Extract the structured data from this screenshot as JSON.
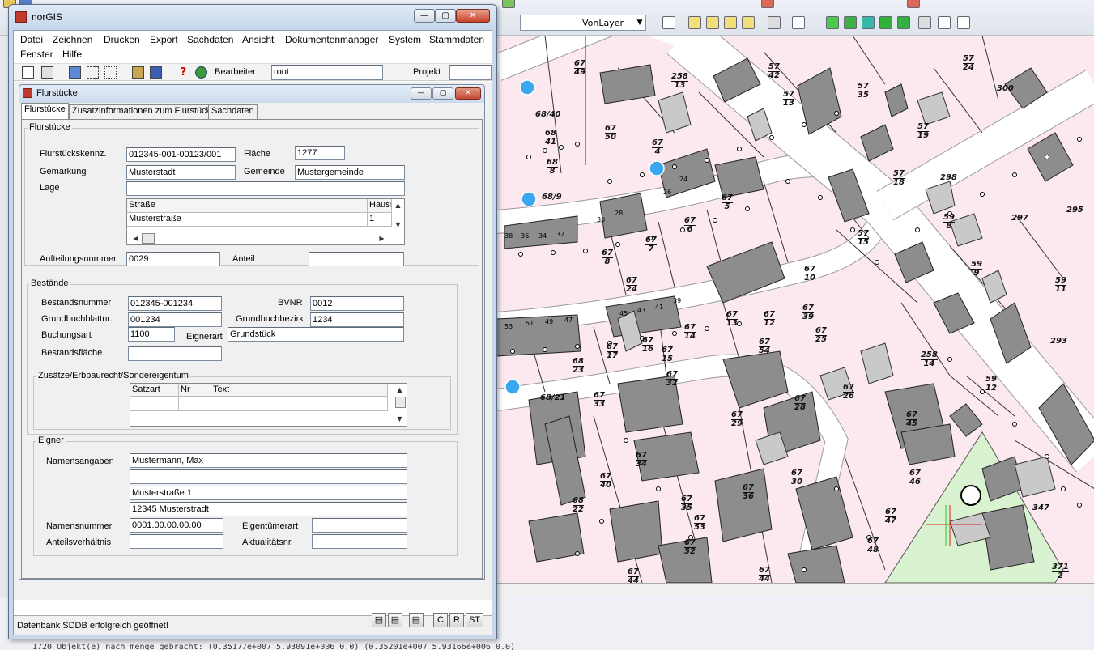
{
  "cad": {
    "layer_select_value": "VonLayer",
    "command_line": "1720 Objekt(e) nach menge gebracht: (0.35177e+007 5.93091e+006 0.0) (0.35201e+007 5.93166e+006 0.0)"
  },
  "window": {
    "title": "norGIS",
    "min": "—",
    "max": "▢",
    "close": "✕"
  },
  "menu": {
    "row1": [
      "Datei",
      "Zeichnen",
      "Drucken",
      "Export",
      "Sachdaten",
      "Ansicht",
      "Dokumentenmanager",
      "System",
      "Stammdaten"
    ],
    "row2": [
      "Fenster",
      "Hilfe"
    ]
  },
  "toolbar": {
    "bearbeiter_label": "Bearbeiter",
    "bearbeiter_value": "root",
    "projekt_label": "Projekt",
    "projekt_value": ""
  },
  "flurstuecke": {
    "title": "Flurstücke",
    "tabs": [
      "Flurstücke",
      "Zusatzinformationen zum Flurstück",
      "Sachdaten"
    ],
    "group_title": "Flurstücke",
    "kennz_label": "Flurstückskennz.",
    "kennz_value": "012345-001-00123/001",
    "flaeche_label": "Fläche",
    "flaeche_value": "1277",
    "gemarkung_label": "Gemarkung",
    "gemarkung_value": "Musterstadt",
    "gemeinde_label": "Gemeinde",
    "gemeinde_value": "Mustergemeinde",
    "lage_label": "Lage",
    "lage_value": "",
    "lage_headers": [
      "Straße",
      "Hausı"
    ],
    "lage_rows": [
      [
        "Musterstraße",
        "1"
      ]
    ],
    "aufteilung_label": "Aufteilungsnummer",
    "aufteilung_value": "0029",
    "anteil_label": "Anteil",
    "anteil_value": ""
  },
  "bestaende": {
    "group_title": "Bestände",
    "bestandsnummer_label": "Bestandsnummer",
    "bestandsnummer_value": "012345-001234",
    "bvnr_label": "BVNR",
    "bvnr_value": "0012",
    "grundbuchblatt_label": "Grundbuchblattnr.",
    "grundbuchblatt_value": "001234",
    "grundbuchbezirk_label": "Grundbuchbezirk",
    "grundbuchbezirk_value": "1234",
    "buchungsart_label": "Buchungsart",
    "buchungsart_value": "1100",
    "eignerart_label": "Eignerart",
    "eignerart_value": "Grundstück",
    "bestandsflaeche_label": "Bestandsfläche",
    "bestandsflaeche_value": "",
    "zusaetze_title": "Zusätze/Erbbaurecht/Sondereigentum",
    "zusaetze_headers": [
      "Satzart",
      "Nr",
      "Text"
    ]
  },
  "eigner": {
    "group_title": "Eigner",
    "namensangaben_label": "Namensangaben",
    "name_lines": [
      "Mustermann, Max",
      "",
      "Musterstraße 1",
      "12345 Musterstradt"
    ],
    "namensnummer_label": "Namensnummer",
    "namensnummer_value": "0001.00.00.00.00",
    "eigentuemerart_label": "Eigentümerart",
    "eigentuemerart_value": "",
    "anteilsverhaeltnis_label": "Anteilsverhältnis",
    "anteilsverhaeltnis_value": "",
    "aktualitaet_label": "Aktualitätsnr.",
    "aktualitaet_value": ""
  },
  "status": {
    "message": "Datenbank SDDB erfolgreich geöffnet!",
    "btn_c": "C",
    "btn_r": "R",
    "btn_st": "ST"
  },
  "map_labels": {
    "parcels": [
      {
        "n": "67",
        "d": "49"
      },
      {
        "n": "258",
        "d": "13"
      },
      {
        "n": "57",
        "d": "42"
      },
      {
        "n": "57",
        "d": "24"
      },
      {
        "n": "67",
        "d": "50"
      },
      {
        "n": "67",
        "d": "4"
      },
      {
        "n": "57",
        "d": "13"
      },
      {
        "n": "57",
        "d": "35"
      },
      {
        "n": "68",
        "d": "41"
      },
      {
        "n": "68",
        "d": "8"
      },
      {
        "n": "57",
        "d": "19"
      },
      {
        "n": "57",
        "d": "18"
      },
      {
        "n": "67",
        "d": "5"
      },
      {
        "n": "67",
        "d": "6"
      },
      {
        "n": "59",
        "d": "8"
      },
      {
        "n": "57",
        "d": "15"
      },
      {
        "n": "67",
        "d": "7"
      },
      {
        "n": "67",
        "d": "8"
      },
      {
        "n": "59",
        "d": "9"
      },
      {
        "n": "59",
        "d": "11"
      },
      {
        "n": "67",
        "d": "10"
      },
      {
        "n": "67",
        "d": "24"
      },
      {
        "n": "67",
        "d": "13"
      },
      {
        "n": "67",
        "d": "12"
      },
      {
        "n": "67",
        "d": "39"
      },
      {
        "n": "67",
        "d": "14"
      },
      {
        "n": "67",
        "d": "17"
      },
      {
        "n": "67",
        "d": "16"
      },
      {
        "n": "67",
        "d": "15"
      },
      {
        "n": "67",
        "d": "54"
      },
      {
        "n": "67",
        "d": "25"
      },
      {
        "n": "258",
        "d": "14"
      },
      {
        "n": "68",
        "d": "23"
      },
      {
        "n": "67",
        "d": "32"
      },
      {
        "n": "67",
        "d": "33"
      },
      {
        "n": "67",
        "d": "28"
      },
      {
        "n": "67",
        "d": "26"
      },
      {
        "n": "59",
        "d": "12"
      },
      {
        "n": "67",
        "d": "29"
      },
      {
        "n": "67",
        "d": "45"
      },
      {
        "n": "67",
        "d": "34"
      },
      {
        "n": "67",
        "d": "40"
      },
      {
        "n": "67",
        "d": "36"
      },
      {
        "n": "67",
        "d": "30"
      },
      {
        "n": "67",
        "d": "46"
      },
      {
        "n": "68",
        "d": "22"
      },
      {
        "n": "67",
        "d": "35"
      },
      {
        "n": "67",
        "d": "53"
      },
      {
        "n": "67",
        "d": "47"
      },
      {
        "n": "67",
        "d": "52"
      },
      {
        "n": "67",
        "d": "48"
      },
      {
        "n": "67",
        "d": "44"
      },
      {
        "n": "67",
        "d": "44"
      },
      {
        "n": "371",
        "d": "2"
      }
    ],
    "plain": [
      "68/40",
      "68/9",
      "68/21",
      "300",
      "298",
      "297",
      "295",
      "293",
      "347"
    ],
    "colors": {
      "parcel_bg": "#fbe9ef",
      "road": "#ffffff",
      "building": "#8d8d8d",
      "green": "#d9f2cf"
    }
  }
}
